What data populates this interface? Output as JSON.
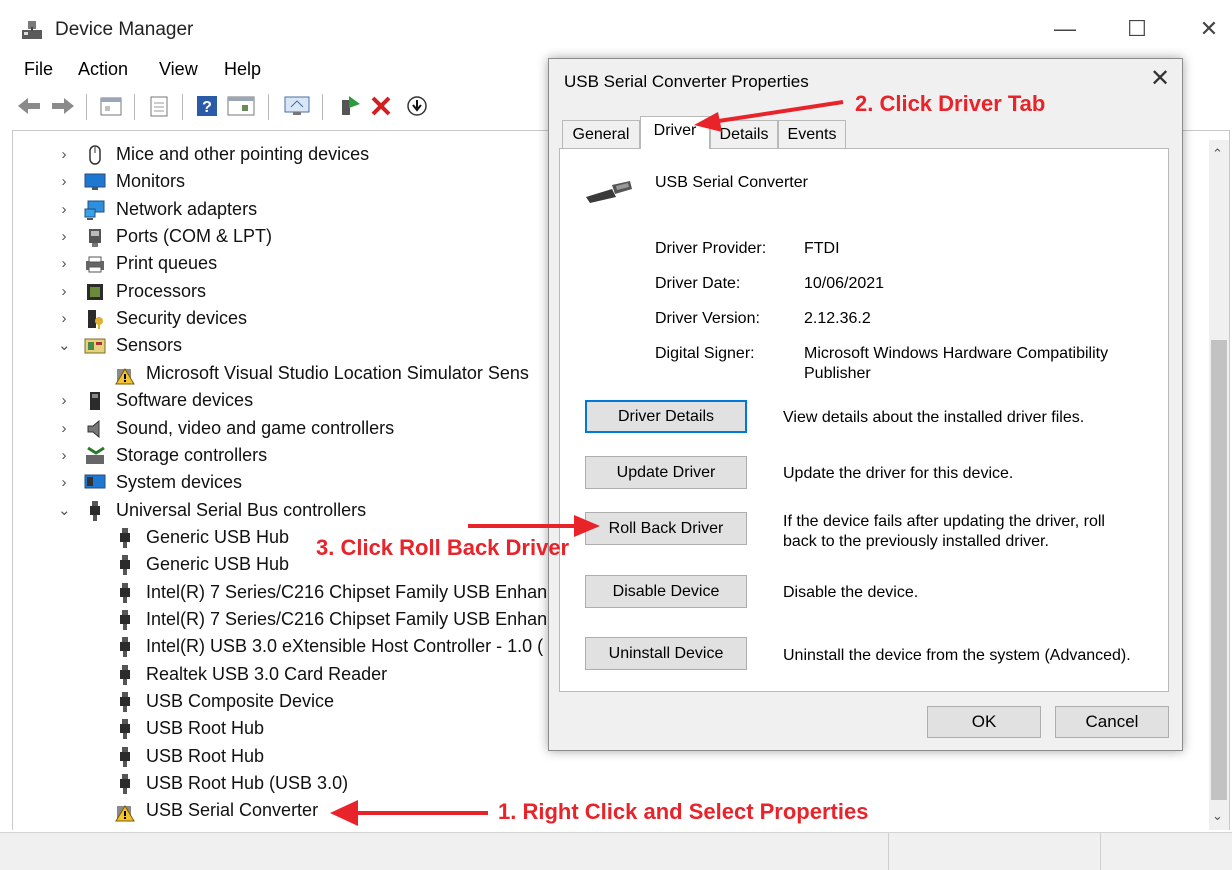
{
  "window": {
    "title": "Device Manager",
    "controls": {
      "minimize": "—",
      "maximize": "☐",
      "close": "✕"
    }
  },
  "menu": [
    "File",
    "Action",
    "View",
    "Help"
  ],
  "tree": [
    {
      "label": "Mice and other pointing devices",
      "chevron": "›",
      "icon": "mouse-icon",
      "indent": 0
    },
    {
      "label": "Monitors",
      "chevron": "›",
      "icon": "monitor-icon",
      "indent": 0
    },
    {
      "label": "Network adapters",
      "chevron": "›",
      "icon": "network-icon",
      "indent": 0
    },
    {
      "label": "Ports (COM & LPT)",
      "chevron": "›",
      "icon": "port-icon",
      "indent": 0
    },
    {
      "label": "Print queues",
      "chevron": "›",
      "icon": "printer-icon",
      "indent": 0
    },
    {
      "label": "Processors",
      "chevron": "›",
      "icon": "processor-icon",
      "indent": 0
    },
    {
      "label": "Security devices",
      "chevron": "›",
      "icon": "security-icon",
      "indent": 0
    },
    {
      "label": "Sensors",
      "chevron": "⌄",
      "icon": "sensor-icon",
      "indent": 0
    },
    {
      "label": "Microsoft Visual Studio Location Simulator Sens",
      "chevron": "",
      "icon": "warning-device-icon",
      "indent": 1
    },
    {
      "label": "Software devices",
      "chevron": "›",
      "icon": "software-device-icon",
      "indent": 0
    },
    {
      "label": "Sound, video and game controllers",
      "chevron": "›",
      "icon": "speaker-icon",
      "indent": 0
    },
    {
      "label": "Storage controllers",
      "chevron": "›",
      "icon": "storage-icon",
      "indent": 0
    },
    {
      "label": "System devices",
      "chevron": "›",
      "icon": "system-icon",
      "indent": 0
    },
    {
      "label": "Universal Serial Bus controllers",
      "chevron": "⌄",
      "icon": "usb-icon",
      "indent": 0
    },
    {
      "label": "Generic USB Hub",
      "chevron": "",
      "icon": "usb-icon",
      "indent": 1
    },
    {
      "label": "Generic USB Hub",
      "chevron": "",
      "icon": "usb-icon",
      "indent": 1
    },
    {
      "label": "Intel(R) 7 Series/C216 Chipset Family USB Enhan",
      "chevron": "",
      "icon": "usb-icon",
      "indent": 1
    },
    {
      "label": "Intel(R) 7 Series/C216 Chipset Family USB Enhan",
      "chevron": "",
      "icon": "usb-icon",
      "indent": 1
    },
    {
      "label": "Intel(R) USB 3.0 eXtensible Host Controller - 1.0 (",
      "chevron": "",
      "icon": "usb-icon",
      "indent": 1
    },
    {
      "label": "Realtek USB 3.0 Card Reader",
      "chevron": "",
      "icon": "usb-icon",
      "indent": 1
    },
    {
      "label": "USB Composite Device",
      "chevron": "",
      "icon": "usb-icon",
      "indent": 1
    },
    {
      "label": "USB Root Hub",
      "chevron": "",
      "icon": "usb-icon",
      "indent": 1
    },
    {
      "label": "USB Root Hub",
      "chevron": "",
      "icon": "usb-icon",
      "indent": 1
    },
    {
      "label": "USB Root Hub (USB 3.0)",
      "chevron": "",
      "icon": "usb-icon",
      "indent": 1
    },
    {
      "label": "USB Serial Converter",
      "chevron": "",
      "icon": "warning-device-icon",
      "indent": 1
    }
  ],
  "dialog": {
    "title": "USB Serial Converter Properties",
    "close": "✕",
    "tabs": [
      "General",
      "Driver",
      "Details",
      "Events"
    ],
    "active_tab": "Driver",
    "device_name": "USB Serial Converter",
    "fields": [
      {
        "label": "Driver Provider:",
        "value": "FTDI"
      },
      {
        "label": "Driver Date:",
        "value": "10/06/2021"
      },
      {
        "label": "Driver Version:",
        "value": "2.12.36.2"
      },
      {
        "label": "Digital Signer:",
        "value": "Microsoft Windows Hardware Compatibility Publisher"
      }
    ],
    "actions": [
      {
        "button": "Driver Details",
        "desc": "View details about the installed driver files."
      },
      {
        "button": "Update Driver",
        "desc": "Update the driver for this device."
      },
      {
        "button": "Roll Back Driver",
        "desc": "If the device fails after updating the driver, roll back to the previously installed driver."
      },
      {
        "button": "Disable Device",
        "desc": "Disable the device."
      },
      {
        "button": "Uninstall Device",
        "desc": "Uninstall the device from the system (Advanced)."
      }
    ],
    "ok": "OK",
    "cancel": "Cancel"
  },
  "annotations": {
    "step1": "1. Right Click and Select Properties",
    "step2": "2. Click Driver Tab",
    "step3": "3. Click Roll Back Driver",
    "color": "#e8232a"
  }
}
